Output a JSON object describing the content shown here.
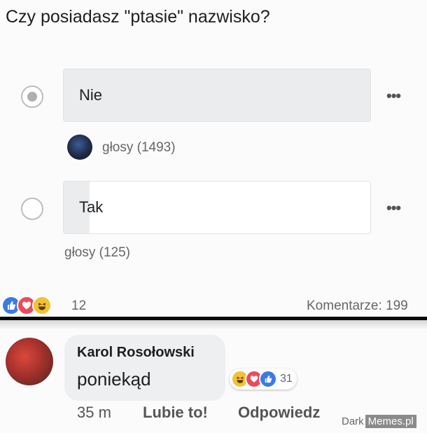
{
  "poll": {
    "question": "Czy posiadasz \"ptasie\" nazwisko?",
    "options": [
      {
        "label": "Nie",
        "votes_label": "głosy (1493)",
        "selected": true,
        "share": 1.0
      },
      {
        "label": "Tak",
        "votes_label": "głosy (125)",
        "selected": false,
        "share": 0.084
      }
    ],
    "more_label": "•••"
  },
  "post_reactions": {
    "icons": [
      "like-icon",
      "love-icon",
      "haha-icon"
    ],
    "count": "12",
    "comments_label": "Komentarze: 199"
  },
  "comment": {
    "author": "Karol Rosołowski",
    "text": "poniekąd",
    "reactions": {
      "icons": [
        "haha-icon",
        "love-icon",
        "like-icon"
      ],
      "count": "31"
    },
    "time": "35 m",
    "like_label": "Lubie to!",
    "reply_label": "Odpowiedz"
  },
  "watermark": {
    "part1": "Dark",
    "part2": "Memes.pl"
  },
  "colors": {
    "like": "#3b7be6",
    "love": "#ea4b5c",
    "haha": "#f3c133",
    "selected_fill": "#ebecee"
  }
}
